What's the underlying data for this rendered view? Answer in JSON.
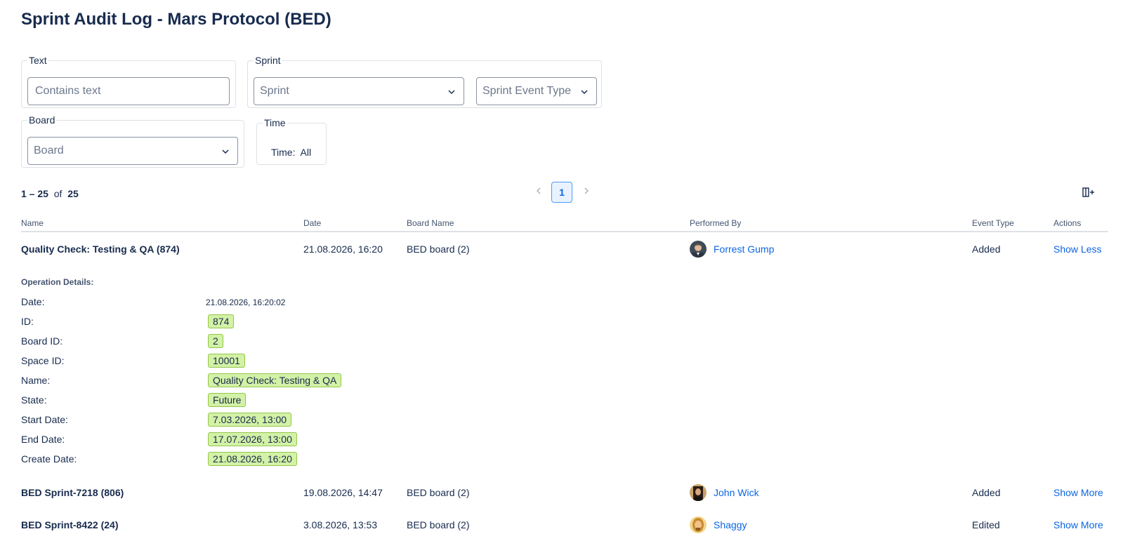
{
  "page": {
    "title": "Sprint Audit Log - Mars Protocol (BED)"
  },
  "filters": {
    "text_group": "Text",
    "text_placeholder": "Contains text",
    "sprint_group": "Sprint",
    "sprint_placeholder": "Sprint",
    "event_type_placeholder": "Sprint Event Type",
    "board_group": "Board",
    "board_placeholder": "Board",
    "time_group": "Time",
    "time_label": "Time:",
    "time_value": "All"
  },
  "pagination": {
    "range": "1 – 25",
    "of": "of",
    "total": "25",
    "current_page": "1"
  },
  "table": {
    "headers": {
      "name": "Name",
      "date": "Date",
      "board": "Board Name",
      "performed_by": "Performed By",
      "event_type": "Event Type",
      "actions": "Actions"
    },
    "rows": [
      {
        "name": "Quality Check: Testing & QA (874)",
        "date": "21.08.2026, 16:20",
        "board": "BED board (2)",
        "user": "Forrest Gump",
        "event": "Added",
        "action": "Show Less"
      },
      {
        "name": "BED Sprint-7218 (806)",
        "date": "19.08.2026, 14:47",
        "board": "BED board (2)",
        "user": "John Wick",
        "event": "Added",
        "action": "Show More"
      },
      {
        "name": "BED Sprint-8422 (24)",
        "date": "3.08.2026, 13:53",
        "board": "BED board (2)",
        "user": "Shaggy",
        "event": "Edited",
        "action": "Show More"
      }
    ]
  },
  "details": {
    "title": "Operation Details:",
    "date_label": "Date:",
    "date_value": "21.08.2026, 16:20:02",
    "fields": [
      {
        "label": "ID:",
        "value": "874"
      },
      {
        "label": "Board ID:",
        "value": "2"
      },
      {
        "label": "Space ID:",
        "value": "10001"
      },
      {
        "label": "Name:",
        "value": "Quality Check: Testing & QA"
      },
      {
        "label": "State:",
        "value": "Future"
      },
      {
        "label": "Start Date:",
        "value": "7.03.2026, 13:00"
      },
      {
        "label": "End Date:",
        "value": "17.07.2026, 13:00"
      },
      {
        "label": "Create Date:",
        "value": "21.08.2026, 16:20"
      }
    ]
  },
  "colors": {
    "link": "#0c66e4",
    "chip_bg": "#d3f1a7",
    "chip_border": "#94c748",
    "page_active_bg": "#e9f2ff"
  },
  "icons": {
    "dropdown": "chevron-down-icon",
    "prev": "chevron-left-icon",
    "next": "chevron-right-icon",
    "columns": "add-column-icon"
  }
}
